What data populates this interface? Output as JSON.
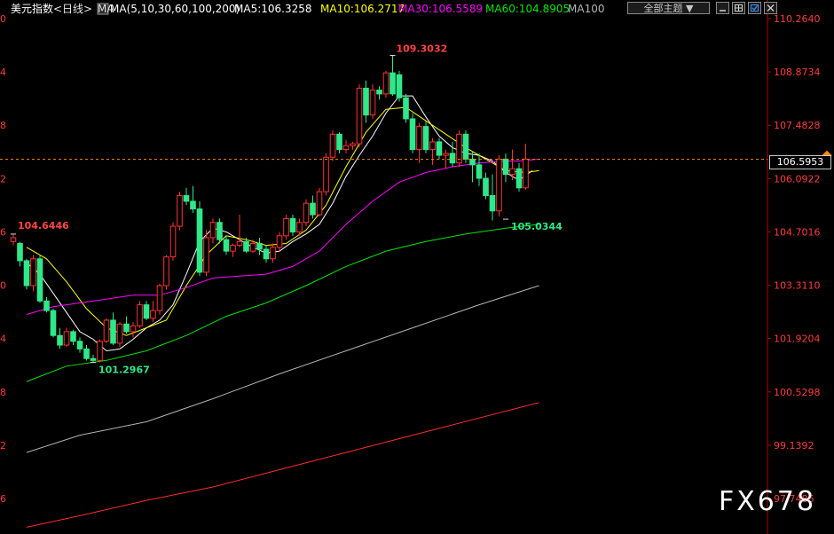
{
  "header": {
    "symbol": "美元指数",
    "period": "<日线>",
    "ma_icon": "MA",
    "ma_params": "MA(5,10,30,60,100,200)",
    "ma5": "MA5:106.3258",
    "ma10": "MA10:106.2717",
    "ma30": "MA30:106.5589",
    "ma60": "MA60:104.8905",
    "ma100": "MA100",
    "colors": {
      "symbol": "#ffffff",
      "period": "#e5e5e5",
      "ma5": "#ffffff",
      "ma10": "#ffff00",
      "ma30": "#ff00ff",
      "ma60": "#00e600",
      "ma100": "#b4b4b4"
    }
  },
  "toolbar": {
    "theme_select": "全部主题 ▼",
    "icons": [
      "minimize-icon",
      "grid-icon",
      "checkbox-icon",
      "close-icon"
    ]
  },
  "current_price": "106.5953",
  "watermark": "FX678",
  "annotations": {
    "high": "109.3032",
    "low_left": "101.2967",
    "low_right": "105.0344",
    "left_price": "104.6446"
  },
  "chart_data": {
    "type": "candlestick",
    "y_axis_labels": [
      "110.2640",
      "108.8734",
      "107.4828",
      "106.0922",
      "104.7016",
      "103.3110",
      "101.9204",
      "100.5298",
      "99.1392",
      "97.7486"
    ],
    "ylim": [
      97.0,
      110.4
    ],
    "current_price": 106.5953,
    "candles": [
      {
        "o": 104.45,
        "h": 104.64,
        "l": 104.35,
        "c": 104.55
      },
      {
        "o": 104.4,
        "h": 104.45,
        "l": 103.8,
        "c": 103.95
      },
      {
        "o": 103.95,
        "h": 104.0,
        "l": 103.2,
        "c": 103.3
      },
      {
        "o": 103.3,
        "h": 104.1,
        "l": 103.15,
        "c": 104.0
      },
      {
        "o": 104.0,
        "h": 104.1,
        "l": 102.85,
        "c": 102.9
      },
      {
        "o": 102.9,
        "h": 103.0,
        "l": 102.6,
        "c": 102.65
      },
      {
        "o": 102.65,
        "h": 102.7,
        "l": 101.95,
        "c": 102.0
      },
      {
        "o": 102.0,
        "h": 102.2,
        "l": 101.65,
        "c": 101.75
      },
      {
        "o": 101.75,
        "h": 102.2,
        "l": 101.7,
        "c": 102.1
      },
      {
        "o": 102.1,
        "h": 102.15,
        "l": 101.75,
        "c": 101.85
      },
      {
        "o": 101.85,
        "h": 101.95,
        "l": 101.55,
        "c": 101.65
      },
      {
        "o": 101.65,
        "h": 101.75,
        "l": 101.35,
        "c": 101.4
      },
      {
        "o": 101.4,
        "h": 101.5,
        "l": 101.3,
        "c": 101.35
      },
      {
        "o": 101.35,
        "h": 101.9,
        "l": 101.3,
        "c": 101.85
      },
      {
        "o": 101.85,
        "h": 102.45,
        "l": 101.8,
        "c": 102.4
      },
      {
        "o": 102.4,
        "h": 102.6,
        "l": 101.75,
        "c": 101.8
      },
      {
        "o": 101.8,
        "h": 102.35,
        "l": 101.7,
        "c": 102.3
      },
      {
        "o": 102.3,
        "h": 102.5,
        "l": 102.05,
        "c": 102.1
      },
      {
        "o": 102.1,
        "h": 102.35,
        "l": 101.95,
        "c": 102.25
      },
      {
        "o": 102.25,
        "h": 102.9,
        "l": 102.2,
        "c": 102.8
      },
      {
        "o": 102.8,
        "h": 102.9,
        "l": 102.4,
        "c": 102.45
      },
      {
        "o": 102.45,
        "h": 102.9,
        "l": 102.35,
        "c": 102.65
      },
      {
        "o": 102.65,
        "h": 103.35,
        "l": 102.55,
        "c": 103.3
      },
      {
        "o": 103.3,
        "h": 104.1,
        "l": 103.2,
        "c": 104.05
      },
      {
        "o": 104.05,
        "h": 104.95,
        "l": 103.95,
        "c": 104.85
      },
      {
        "o": 104.85,
        "h": 105.75,
        "l": 104.75,
        "c": 105.65
      },
      {
        "o": 105.65,
        "h": 105.85,
        "l": 105.4,
        "c": 105.5
      },
      {
        "o": 105.5,
        "h": 105.9,
        "l": 105.2,
        "c": 105.3
      },
      {
        "o": 105.3,
        "h": 105.5,
        "l": 103.55,
        "c": 103.65
      },
      {
        "o": 103.65,
        "h": 104.75,
        "l": 103.55,
        "c": 104.55
      },
      {
        "o": 104.55,
        "h": 105.05,
        "l": 104.4,
        "c": 104.95
      },
      {
        "o": 104.95,
        "h": 105.05,
        "l": 104.4,
        "c": 104.5
      },
      {
        "o": 104.5,
        "h": 104.6,
        "l": 104.1,
        "c": 104.2
      },
      {
        "o": 104.2,
        "h": 104.4,
        "l": 104.05,
        "c": 104.35
      },
      {
        "o": 104.35,
        "h": 105.15,
        "l": 104.3,
        "c": 104.45
      },
      {
        "o": 104.45,
        "h": 104.55,
        "l": 104.15,
        "c": 104.2
      },
      {
        "o": 104.2,
        "h": 104.5,
        "l": 104.15,
        "c": 104.4
      },
      {
        "o": 104.4,
        "h": 104.55,
        "l": 104.1,
        "c": 104.25
      },
      {
        "o": 104.25,
        "h": 104.35,
        "l": 103.9,
        "c": 104.0
      },
      {
        "o": 104.0,
        "h": 104.4,
        "l": 103.9,
        "c": 104.3
      },
      {
        "o": 104.3,
        "h": 104.7,
        "l": 104.2,
        "c": 104.6
      },
      {
        "o": 104.6,
        "h": 105.15,
        "l": 104.5,
        "c": 105.05
      },
      {
        "o": 105.05,
        "h": 105.15,
        "l": 104.6,
        "c": 104.7
      },
      {
        "o": 104.7,
        "h": 105.05,
        "l": 104.6,
        "c": 104.95
      },
      {
        "o": 104.95,
        "h": 105.55,
        "l": 104.85,
        "c": 105.45
      },
      {
        "o": 105.45,
        "h": 105.65,
        "l": 105.05,
        "c": 105.15
      },
      {
        "o": 105.15,
        "h": 105.85,
        "l": 105.1,
        "c": 105.75
      },
      {
        "o": 105.75,
        "h": 106.75,
        "l": 105.65,
        "c": 106.65
      },
      {
        "o": 106.65,
        "h": 107.35,
        "l": 106.55,
        "c": 107.25
      },
      {
        "o": 107.25,
        "h": 107.3,
        "l": 106.75,
        "c": 106.85
      },
      {
        "o": 106.85,
        "h": 107.1,
        "l": 106.75,
        "c": 106.95
      },
      {
        "o": 106.95,
        "h": 107.05,
        "l": 106.85,
        "c": 107.0
      },
      {
        "o": 107.0,
        "h": 108.55,
        "l": 106.9,
        "c": 108.45
      },
      {
        "o": 108.45,
        "h": 108.65,
        "l": 107.55,
        "c": 107.75
      },
      {
        "o": 107.75,
        "h": 108.55,
        "l": 107.65,
        "c": 108.4
      },
      {
        "o": 108.4,
        "h": 108.5,
        "l": 108.15,
        "c": 108.3
      },
      {
        "o": 108.3,
        "h": 108.9,
        "l": 108.2,
        "c": 108.85
      },
      {
        "o": 108.85,
        "h": 109.3,
        "l": 108.25,
        "c": 108.3
      },
      {
        "o": 108.8,
        "h": 108.9,
        "l": 108.1,
        "c": 108.2
      },
      {
        "o": 108.2,
        "h": 108.3,
        "l": 107.55,
        "c": 107.65
      },
      {
        "o": 107.65,
        "h": 107.8,
        "l": 106.75,
        "c": 106.85
      },
      {
        "o": 106.85,
        "h": 107.55,
        "l": 106.5,
        "c": 107.45
      },
      {
        "o": 107.45,
        "h": 107.6,
        "l": 106.75,
        "c": 106.85
      },
      {
        "o": 106.85,
        "h": 107.15,
        "l": 106.45,
        "c": 107.05
      },
      {
        "o": 107.05,
        "h": 107.15,
        "l": 106.6,
        "c": 106.7
      },
      {
        "o": 106.7,
        "h": 106.85,
        "l": 106.35,
        "c": 106.75
      },
      {
        "o": 106.75,
        "h": 107.05,
        "l": 106.4,
        "c": 106.5
      },
      {
        "o": 106.5,
        "h": 107.35,
        "l": 106.4,
        "c": 107.25
      },
      {
        "o": 107.25,
        "h": 107.35,
        "l": 106.5,
        "c": 106.6
      },
      {
        "o": 106.6,
        "h": 106.8,
        "l": 106.0,
        "c": 106.45
      },
      {
        "o": 106.45,
        "h": 106.75,
        "l": 105.9,
        "c": 106.1
      },
      {
        "o": 106.1,
        "h": 106.25,
        "l": 105.55,
        "c": 105.65
      },
      {
        "o": 105.65,
        "h": 106.2,
        "l": 105.0,
        "c": 105.25
      },
      {
        "o": 105.25,
        "h": 106.7,
        "l": 105.1,
        "c": 106.6
      },
      {
        "o": 106.6,
        "h": 106.75,
        "l": 106.0,
        "c": 106.2
      },
      {
        "o": 106.2,
        "h": 106.85,
        "l": 106.05,
        "c": 106.35
      },
      {
        "o": 106.35,
        "h": 106.5,
        "l": 105.75,
        "c": 105.85
      },
      {
        "o": 105.85,
        "h": 107.0,
        "l": 105.8,
        "c": 106.6
      }
    ],
    "series": [
      {
        "name": "MA5",
        "color": "#ffffff",
        "x": [
          2,
          4,
          6,
          8,
          10,
          12,
          14,
          16,
          18,
          20,
          22,
          24,
          26,
          28,
          30,
          32,
          34,
          36,
          38,
          40,
          42,
          44,
          46,
          48,
          50,
          52,
          54,
          56,
          58,
          60,
          62,
          64,
          66,
          68,
          70,
          72,
          74,
          76,
          78
        ],
        "values": [
          103.9,
          103.6,
          103.1,
          102.6,
          102.1,
          101.9,
          101.6,
          101.65,
          101.9,
          102.2,
          102.4,
          102.8,
          103.6,
          104.45,
          104.8,
          104.7,
          104.5,
          104.3,
          104.15,
          104.2,
          104.45,
          104.65,
          104.9,
          105.45,
          106.15,
          106.7,
          107.2,
          107.8,
          108.25,
          108.25,
          107.7,
          107.2,
          106.9,
          106.75,
          106.7,
          106.55,
          106.25,
          106.05,
          106.3
        ]
      },
      {
        "name": "MA10",
        "color": "#ffff00",
        "x": [
          2,
          5,
          8,
          11,
          14,
          17,
          20,
          23,
          26,
          29,
          32,
          35,
          38,
          41,
          44,
          47,
          50,
          53,
          56,
          59,
          62,
          65,
          68,
          71,
          74,
          77,
          79
        ],
        "values": [
          104.3,
          104.0,
          103.4,
          102.7,
          102.2,
          102.0,
          102.2,
          102.4,
          103.3,
          104.1,
          104.6,
          104.5,
          104.35,
          104.4,
          104.75,
          105.4,
          106.4,
          107.3,
          107.9,
          107.95,
          107.6,
          107.25,
          106.9,
          106.6,
          106.3,
          106.25,
          106.3
        ]
      },
      {
        "name": "MA30",
        "color": "#ff00ff",
        "x": [
          2,
          6,
          10,
          14,
          18,
          22,
          26,
          30,
          34,
          38,
          42,
          46,
          50,
          54,
          58,
          62,
          66,
          70,
          74,
          76,
          79
        ],
        "values": [
          102.55,
          102.75,
          102.85,
          102.95,
          103.05,
          103.05,
          103.25,
          103.5,
          103.55,
          103.6,
          103.8,
          104.2,
          104.9,
          105.5,
          106.0,
          106.25,
          106.4,
          106.5,
          106.55,
          106.55,
          106.6
        ]
      },
      {
        "name": "MA60",
        "color": "#00e600",
        "x": [
          2,
          8,
          14,
          20,
          26,
          32,
          38,
          44,
          50,
          56,
          62,
          68,
          74,
          79
        ],
        "values": [
          100.8,
          101.2,
          101.35,
          101.6,
          102.0,
          102.5,
          102.85,
          103.3,
          103.8,
          104.2,
          104.45,
          104.65,
          104.8,
          104.9
        ]
      },
      {
        "name": "MA100",
        "color": "#b4b4b4",
        "x": [
          2,
          10,
          20,
          30,
          40,
          50,
          60,
          70,
          79
        ],
        "values": [
          98.95,
          99.4,
          99.75,
          100.35,
          101.0,
          101.6,
          102.2,
          102.8,
          103.3
        ]
      },
      {
        "name": "MA200",
        "color": "#ff2a2a",
        "x": [
          2,
          10,
          20,
          30,
          40,
          50,
          60,
          70,
          79
        ],
        "values": [
          97.0,
          97.3,
          97.7,
          98.05,
          98.5,
          98.95,
          99.4,
          99.85,
          100.25
        ]
      }
    ]
  }
}
